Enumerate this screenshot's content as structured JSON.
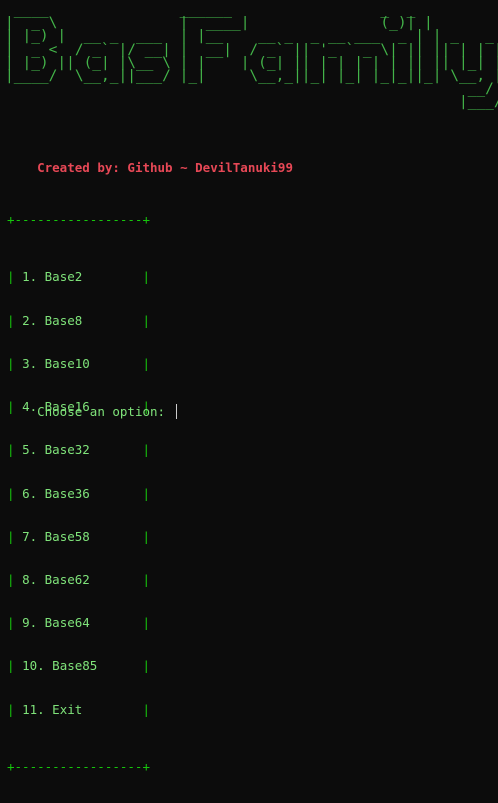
{
  "banner": {
    "ascii_art": " ____               ______                 _  _\n|  _ \\              |  ____|               (_)| |\n| |_) |  __ _  ___  | |__    __ _  _ __ ___  _ | | _   _\n|  _ <  / _` |/ __| |  __|  / _` || '_ ` _ \\| || || | | |\n| |_) || (_| |\\__ \\ | |    | (_| || | | | | | || || |_| |\n|____/  \\__,_||___/ |_|     \\__,_||_| |_| |_|_||_| \\__, |\n                                                     __/ |\n                                                    |___/",
    "title": "BaseFamily"
  },
  "credit": {
    "text": "Created by: Github ~ DevilTanuki99"
  },
  "menu": {
    "top_border": "+-----------------+",
    "bottom_border": "+-----------------+",
    "items": [
      "1. Base2",
      "2. Base8",
      "3. Base10",
      "4. Base16",
      "5. Base32",
      "6. Base36",
      "7. Base58",
      "8. Base62",
      "9. Base64",
      "10. Base85",
      "11. Exit"
    ]
  },
  "prompt": {
    "text": "Choose an option: "
  },
  "colors": {
    "background": "#0c0c0c",
    "banner_green": "#43b449",
    "credit_red": "#e74856",
    "menu_green": "#16c60c",
    "item_text": "#7fe37a"
  }
}
